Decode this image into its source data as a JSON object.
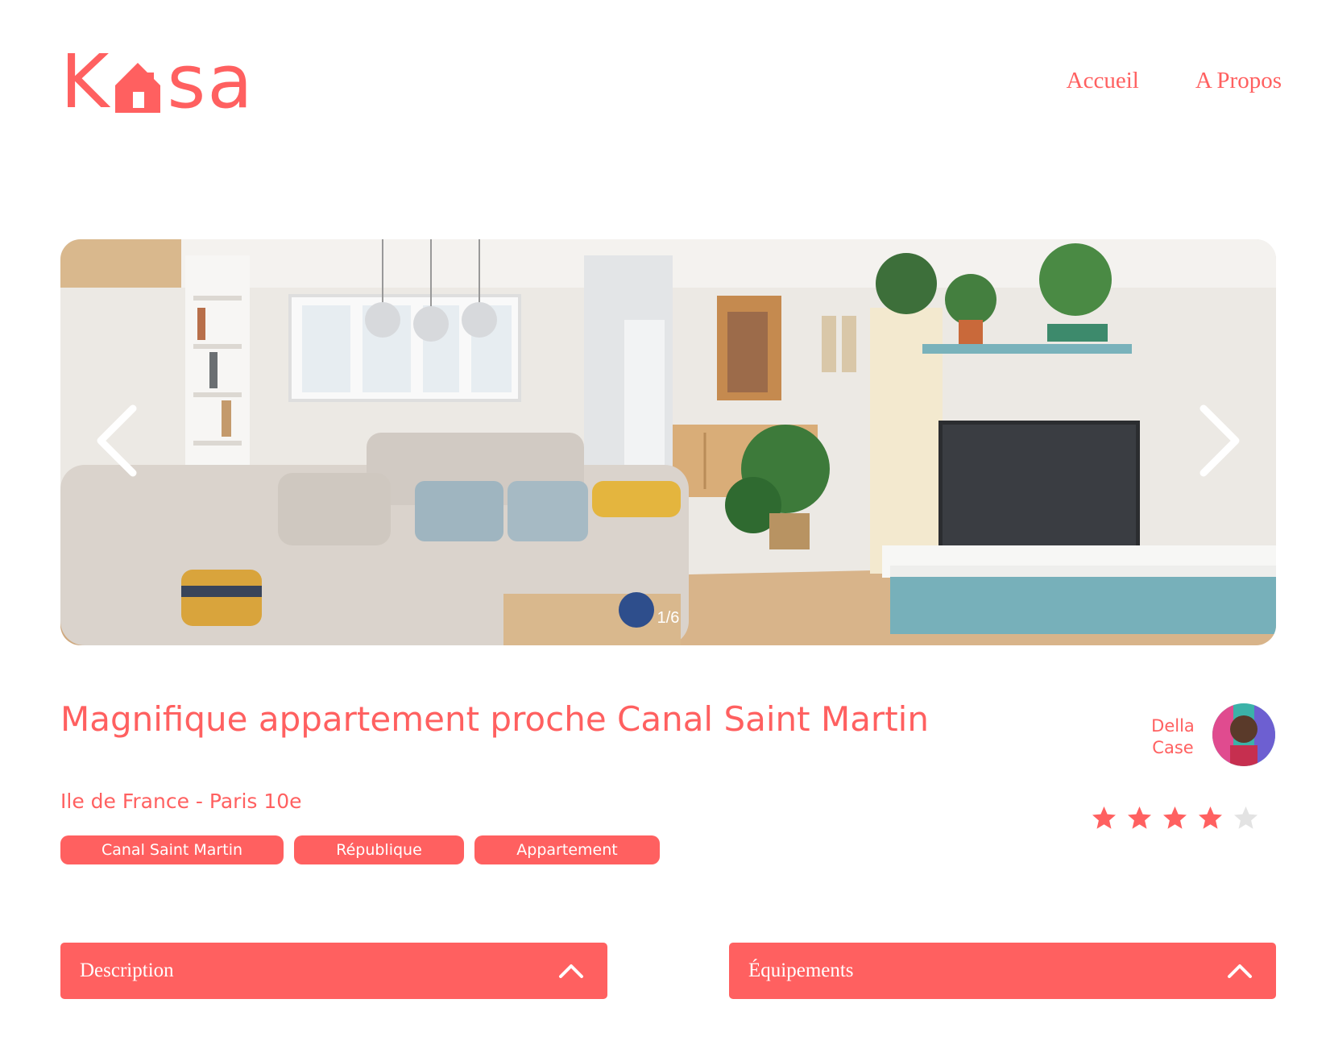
{
  "header": {
    "logo": {
      "letters_left": "K",
      "letters_right": "sa",
      "house_icon": "house-icon"
    },
    "nav": [
      {
        "label": "Accueil"
      },
      {
        "label": "A Propos"
      }
    ]
  },
  "gallery": {
    "counter": "1/6",
    "prev_icon": "chevron-left-icon",
    "next_icon": "chevron-right-icon"
  },
  "listing": {
    "title": "Magnifique appartement proche Canal Saint Martin",
    "location": "Ile de France - Paris 10e",
    "tags": [
      "Canal Saint Martin",
      "République",
      "Appartement"
    ],
    "host": {
      "first_name": "Della",
      "last_name": "Case"
    },
    "rating": 4,
    "rating_max": 5
  },
  "collapses": {
    "description": {
      "label": "Description",
      "icon": "chevron-up-icon"
    },
    "equipments": {
      "label": "Équipements",
      "icon": "chevron-up-icon"
    }
  },
  "colors": {
    "accent": "#FF6060",
    "star_empty": "#E3E3E3",
    "white": "#FFFFFF"
  }
}
